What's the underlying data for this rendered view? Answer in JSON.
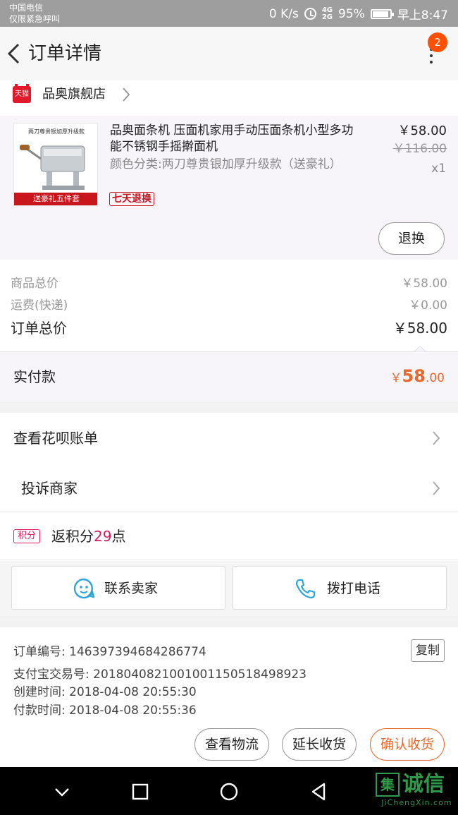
{
  "status_bar": {
    "carrier": "中国电信",
    "emergency": "仅限紧急呼叫",
    "network_speed": "0 K/s",
    "signal": "4G\n2G",
    "battery": "95%",
    "time": "早上8:47"
  },
  "header": {
    "title": "订单详情",
    "badge_count": "2"
  },
  "store": {
    "platform_tag": "天猫",
    "name": "品奥旗舰店"
  },
  "product": {
    "thumb_caption": "两刀尊贵银加厚升级款",
    "thumb_banner": "送豪礼五件套",
    "title": "品奥面条机 压面机家用手动压面条机小型多功能不锈钢手摇擀面机",
    "spec": "颜色分类:两刀尊贵银加厚升级款（送豪礼）",
    "return_tag": "七天退换",
    "price": "￥58.00",
    "original_price": "￥116.00",
    "quantity": "x1",
    "refund_button": "退换"
  },
  "totals": {
    "goods_label": "商品总价",
    "goods_value": "￥58.00",
    "shipping_label": "运费(快递)",
    "shipping_value": "￥0.00",
    "order_total_label": "订单总价",
    "order_total_value": "￥58.00",
    "paid_label": "实付款",
    "paid_currency": "￥",
    "paid_integer": "58",
    "paid_decimal": ".00"
  },
  "links": {
    "huabei": "查看花呗账单",
    "complain": "投诉商家",
    "points_tag": "积分",
    "points_prefix": "返积分",
    "points_value": "29",
    "points_suffix": "点"
  },
  "contact": {
    "seller": "联系卖家",
    "phone": "拨打电话"
  },
  "order_info": {
    "order_no": "订单编号: 146397394684286774",
    "alipay_no": "支付宝交易号: 2018040821001001150518498923",
    "created": "创建时间: 2018-04-08 20:55:30",
    "paid": "付款时间: 2018-04-08 20:55:36",
    "copy_button": "复制"
  },
  "actions": {
    "logistics": "查看物流",
    "extend": "延长收货",
    "confirm": "确认收货"
  },
  "watermark": {
    "box": "集",
    "text": "诚信",
    "url": "JiChengXin.com"
  },
  "colors": {
    "accent": "#e8682d",
    "badge": "#ff5000",
    "tmall_red": "#e01a2b",
    "points_pink": "#e0195b",
    "contact_blue": "#2aa4e0"
  },
  "icons": {
    "back": "chevron-left-icon",
    "more": "more-vertical-icon",
    "store_chevron": "chevron-right-icon",
    "seller": "chat-face-icon",
    "phone": "phone-icon",
    "nav_back": "triangle-back-icon",
    "nav_home": "circle-home-icon",
    "nav_recent": "square-recent-icon",
    "nav_down": "chevron-down-icon"
  }
}
